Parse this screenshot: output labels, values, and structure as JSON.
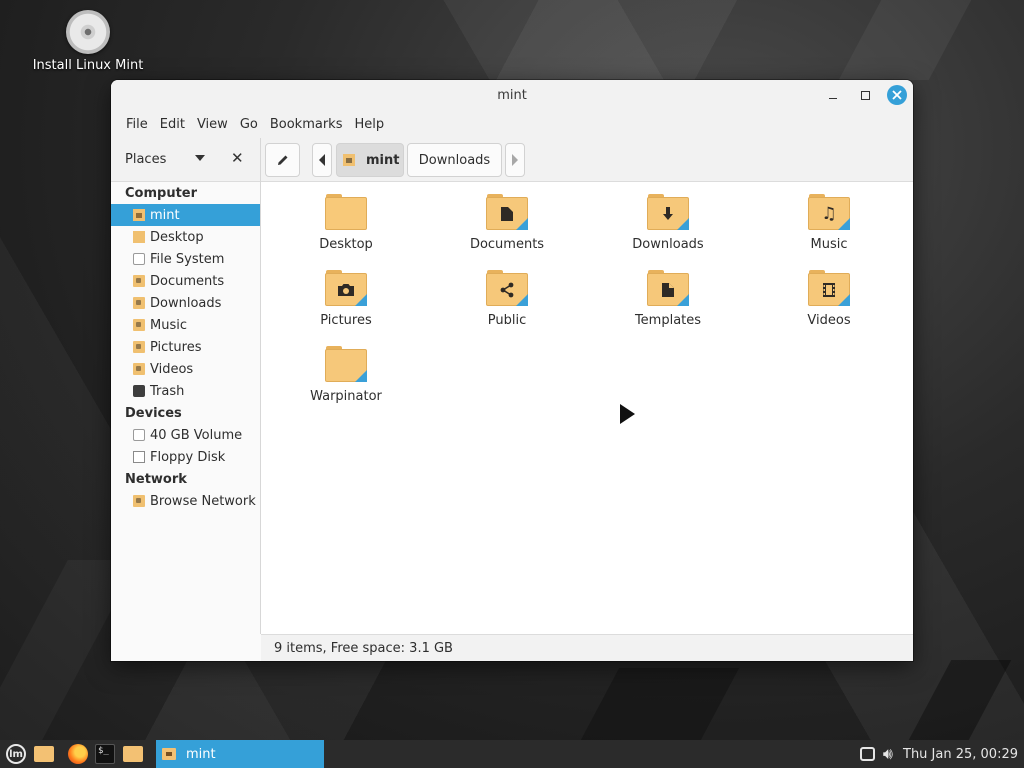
{
  "desktop": {
    "icon_label": "Install Linux Mint"
  },
  "window": {
    "title": "mint",
    "menu": [
      "File",
      "Edit",
      "View",
      "Go",
      "Bookmarks",
      "Help"
    ],
    "places_label": "Places",
    "breadcrumb": [
      "mint",
      "Downloads"
    ],
    "accent_color": "#35a0d8"
  },
  "sidebar": {
    "sections": [
      {
        "title": "Computer",
        "items": [
          {
            "label": "mint",
            "icon": "home-folder-icon",
            "active": true
          },
          {
            "label": "Desktop",
            "icon": "desktop-folder-icon"
          },
          {
            "label": "File System",
            "icon": "drive-icon"
          },
          {
            "label": "Documents",
            "icon": "documents-folder-icon"
          },
          {
            "label": "Downloads",
            "icon": "downloads-folder-icon"
          },
          {
            "label": "Music",
            "icon": "music-folder-icon"
          },
          {
            "label": "Pictures",
            "icon": "pictures-folder-icon"
          },
          {
            "label": "Videos",
            "icon": "videos-folder-icon"
          },
          {
            "label": "Trash",
            "icon": "trash-icon"
          }
        ]
      },
      {
        "title": "Devices",
        "items": [
          {
            "label": "40 GB Volume",
            "icon": "drive-icon"
          },
          {
            "label": "Floppy Disk",
            "icon": "floppy-icon"
          }
        ]
      },
      {
        "title": "Network",
        "items": [
          {
            "label": "Browse Network",
            "icon": "network-folder-icon"
          }
        ]
      }
    ]
  },
  "files": [
    {
      "label": "Desktop",
      "icon": "desktop-folder-icon"
    },
    {
      "label": "Documents",
      "icon": "documents-folder-icon"
    },
    {
      "label": "Downloads",
      "icon": "downloads-folder-icon"
    },
    {
      "label": "Music",
      "icon": "music-folder-icon"
    },
    {
      "label": "Pictures",
      "icon": "pictures-folder-icon"
    },
    {
      "label": "Public",
      "icon": "public-folder-icon"
    },
    {
      "label": "Templates",
      "icon": "templates-folder-icon"
    },
    {
      "label": "Videos",
      "icon": "videos-folder-icon"
    },
    {
      "label": "Warpinator",
      "icon": "warpinator-folder-icon"
    }
  ],
  "status": "9 items, Free space: 3.1 GB",
  "taskbar": {
    "task_label": "mint",
    "clock": "Thu Jan 25, 00:29"
  }
}
